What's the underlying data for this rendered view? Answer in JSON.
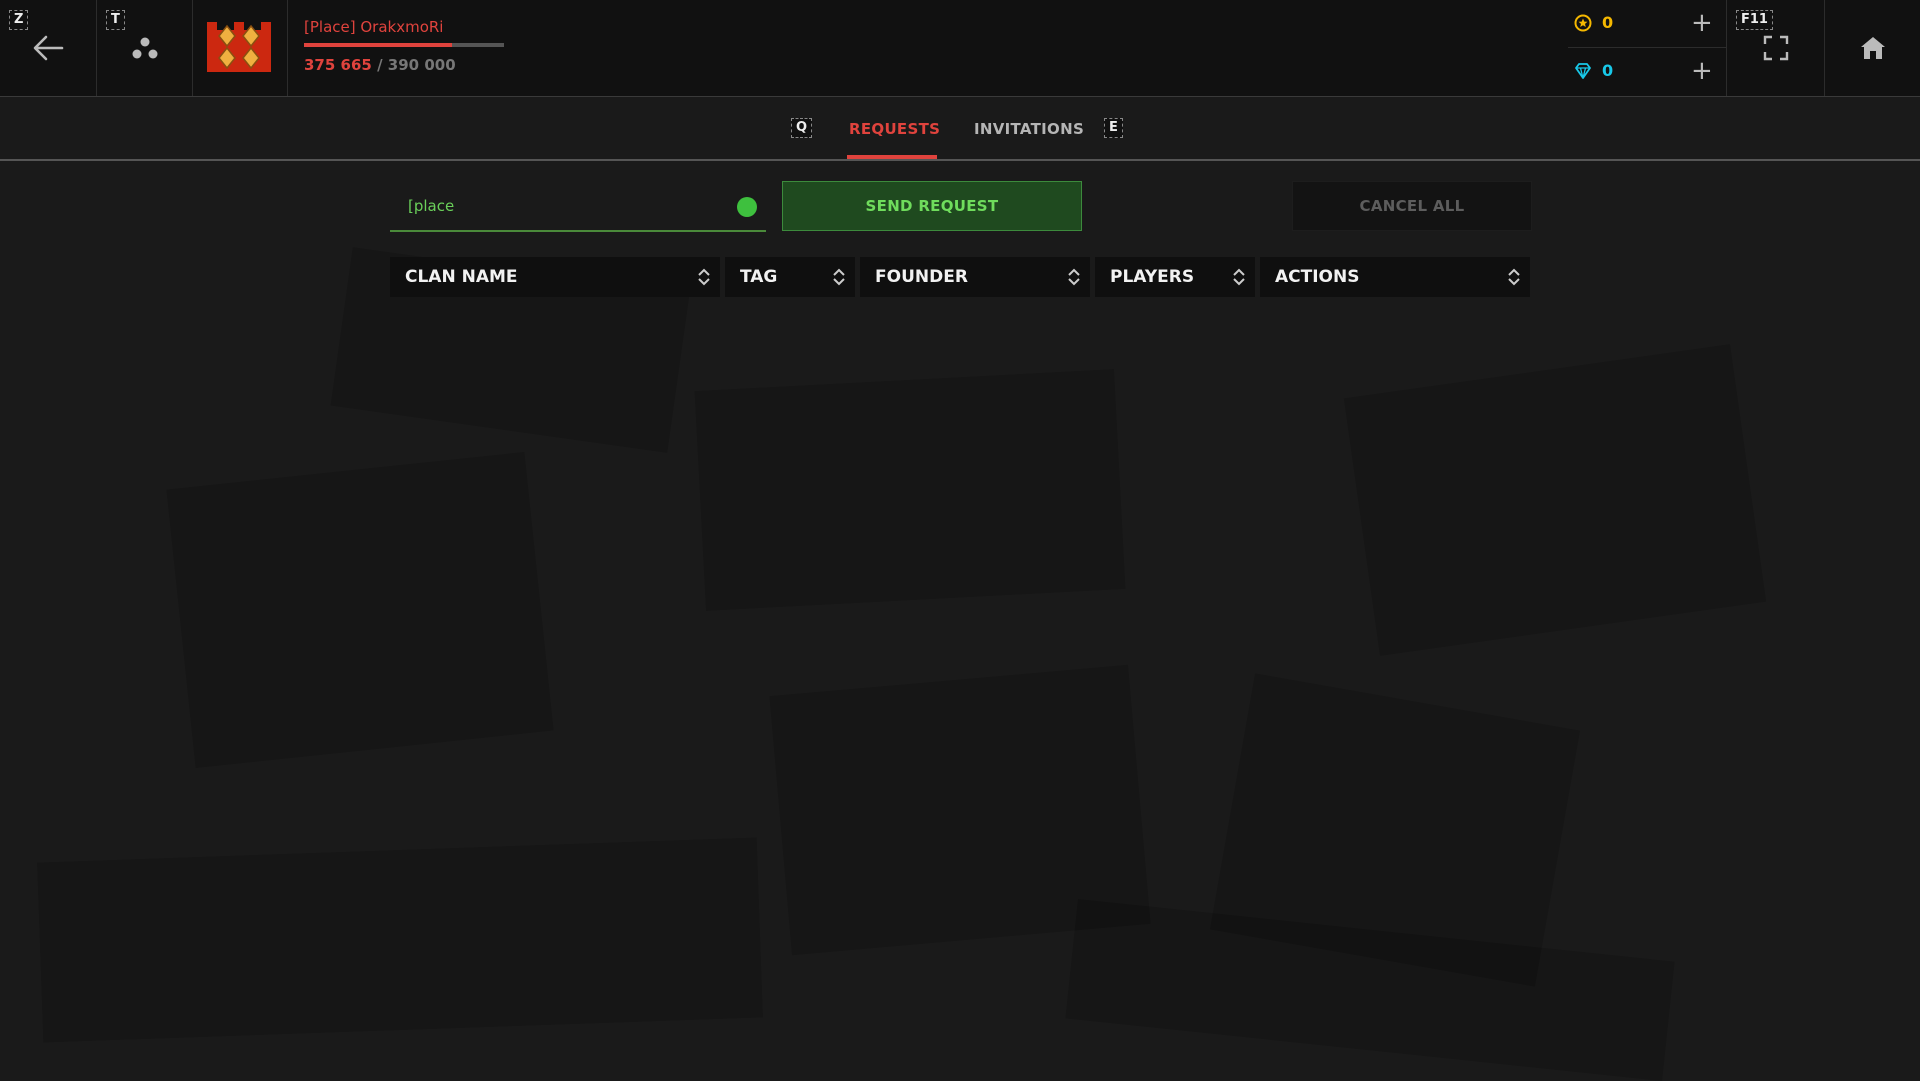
{
  "topbar": {
    "back_hotkey": "Z",
    "party_hotkey": "T",
    "player_name": "[Place] OrakxmoRi",
    "xp_current": "375 665",
    "xp_separator": " / ",
    "xp_max": "390 000",
    "xp_progress": 0.7386,
    "coins": "0",
    "gems": "0",
    "fullscreen_hotkey": "F11",
    "colors": {
      "accent": "#e0433d",
      "coins": "#f5b800",
      "gems": "#18c8e8"
    }
  },
  "tabs": {
    "prev_hotkey": "Q",
    "next_hotkey": "E",
    "items": [
      {
        "label": "REQUESTS",
        "active": true
      },
      {
        "label": "INVITATIONS",
        "active": false
      }
    ]
  },
  "search": {
    "value": "[place",
    "status_color": "#3ec03e"
  },
  "buttons": {
    "send_request": "SEND REQUEST",
    "cancel_all": "CANCEL ALL"
  },
  "table": {
    "columns": [
      "CLAN NAME",
      "TAG",
      "FOUNDER",
      "PLAYERS",
      "ACTIONS"
    ],
    "rows": []
  },
  "icons": {
    "back": "arrow-left-icon",
    "party": "party-icon",
    "clan_emblem": "clan-emblem-icon",
    "coin": "coin-icon",
    "gem": "gem-icon",
    "fullscreen": "fullscreen-icon",
    "home": "home-icon",
    "sort": "sort-icon"
  }
}
